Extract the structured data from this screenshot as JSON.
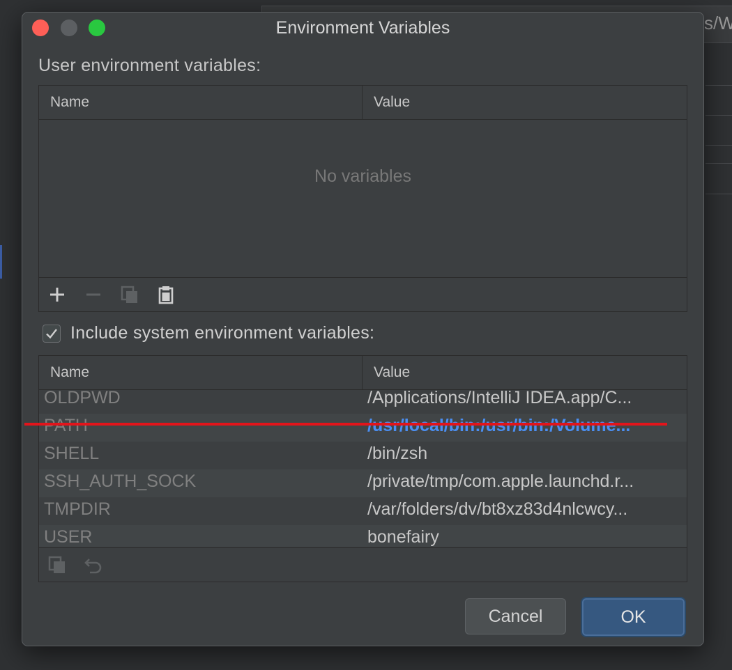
{
  "window": {
    "title": "Environment Variables",
    "background_field_text": "s/W"
  },
  "user_section": {
    "label": "User environment variables:",
    "columns": [
      "Name",
      "Value"
    ],
    "empty_text": "No variables",
    "toolbar": {
      "add_icon": "plus-icon",
      "remove_icon": "minus-icon",
      "copy_icon": "copy-icon",
      "paste_icon": "paste-icon"
    }
  },
  "system_section": {
    "checkbox_label": "Include system environment variables:",
    "checked": true,
    "columns": [
      "Name",
      "Value"
    ],
    "rows": [
      {
        "name": "OLDPWD",
        "value": "/Applications/IntelliJ IDEA.app/C..."
      },
      {
        "name": "PATH",
        "value": "/usr/local/bin:/usr/bin:/Volume...",
        "modified": true
      },
      {
        "name": "SHELL",
        "value": "/bin/zsh"
      },
      {
        "name": "SSH_AUTH_SOCK",
        "value": "/private/tmp/com.apple.launchd.r..."
      },
      {
        "name": "TMPDIR",
        "value": "/var/folders/dv/bt8xz83d4nlcwcy..."
      },
      {
        "name": "USER",
        "value": "bonefairy"
      }
    ],
    "toolbar": {
      "copy_icon": "copy-icon",
      "undo_icon": "undo-icon"
    }
  },
  "buttons": {
    "cancel": "Cancel",
    "ok": "OK"
  },
  "colors": {
    "modified_value": "#4b8ff2",
    "annotation_underline": "#e3141b",
    "ok_button": "#365880"
  }
}
